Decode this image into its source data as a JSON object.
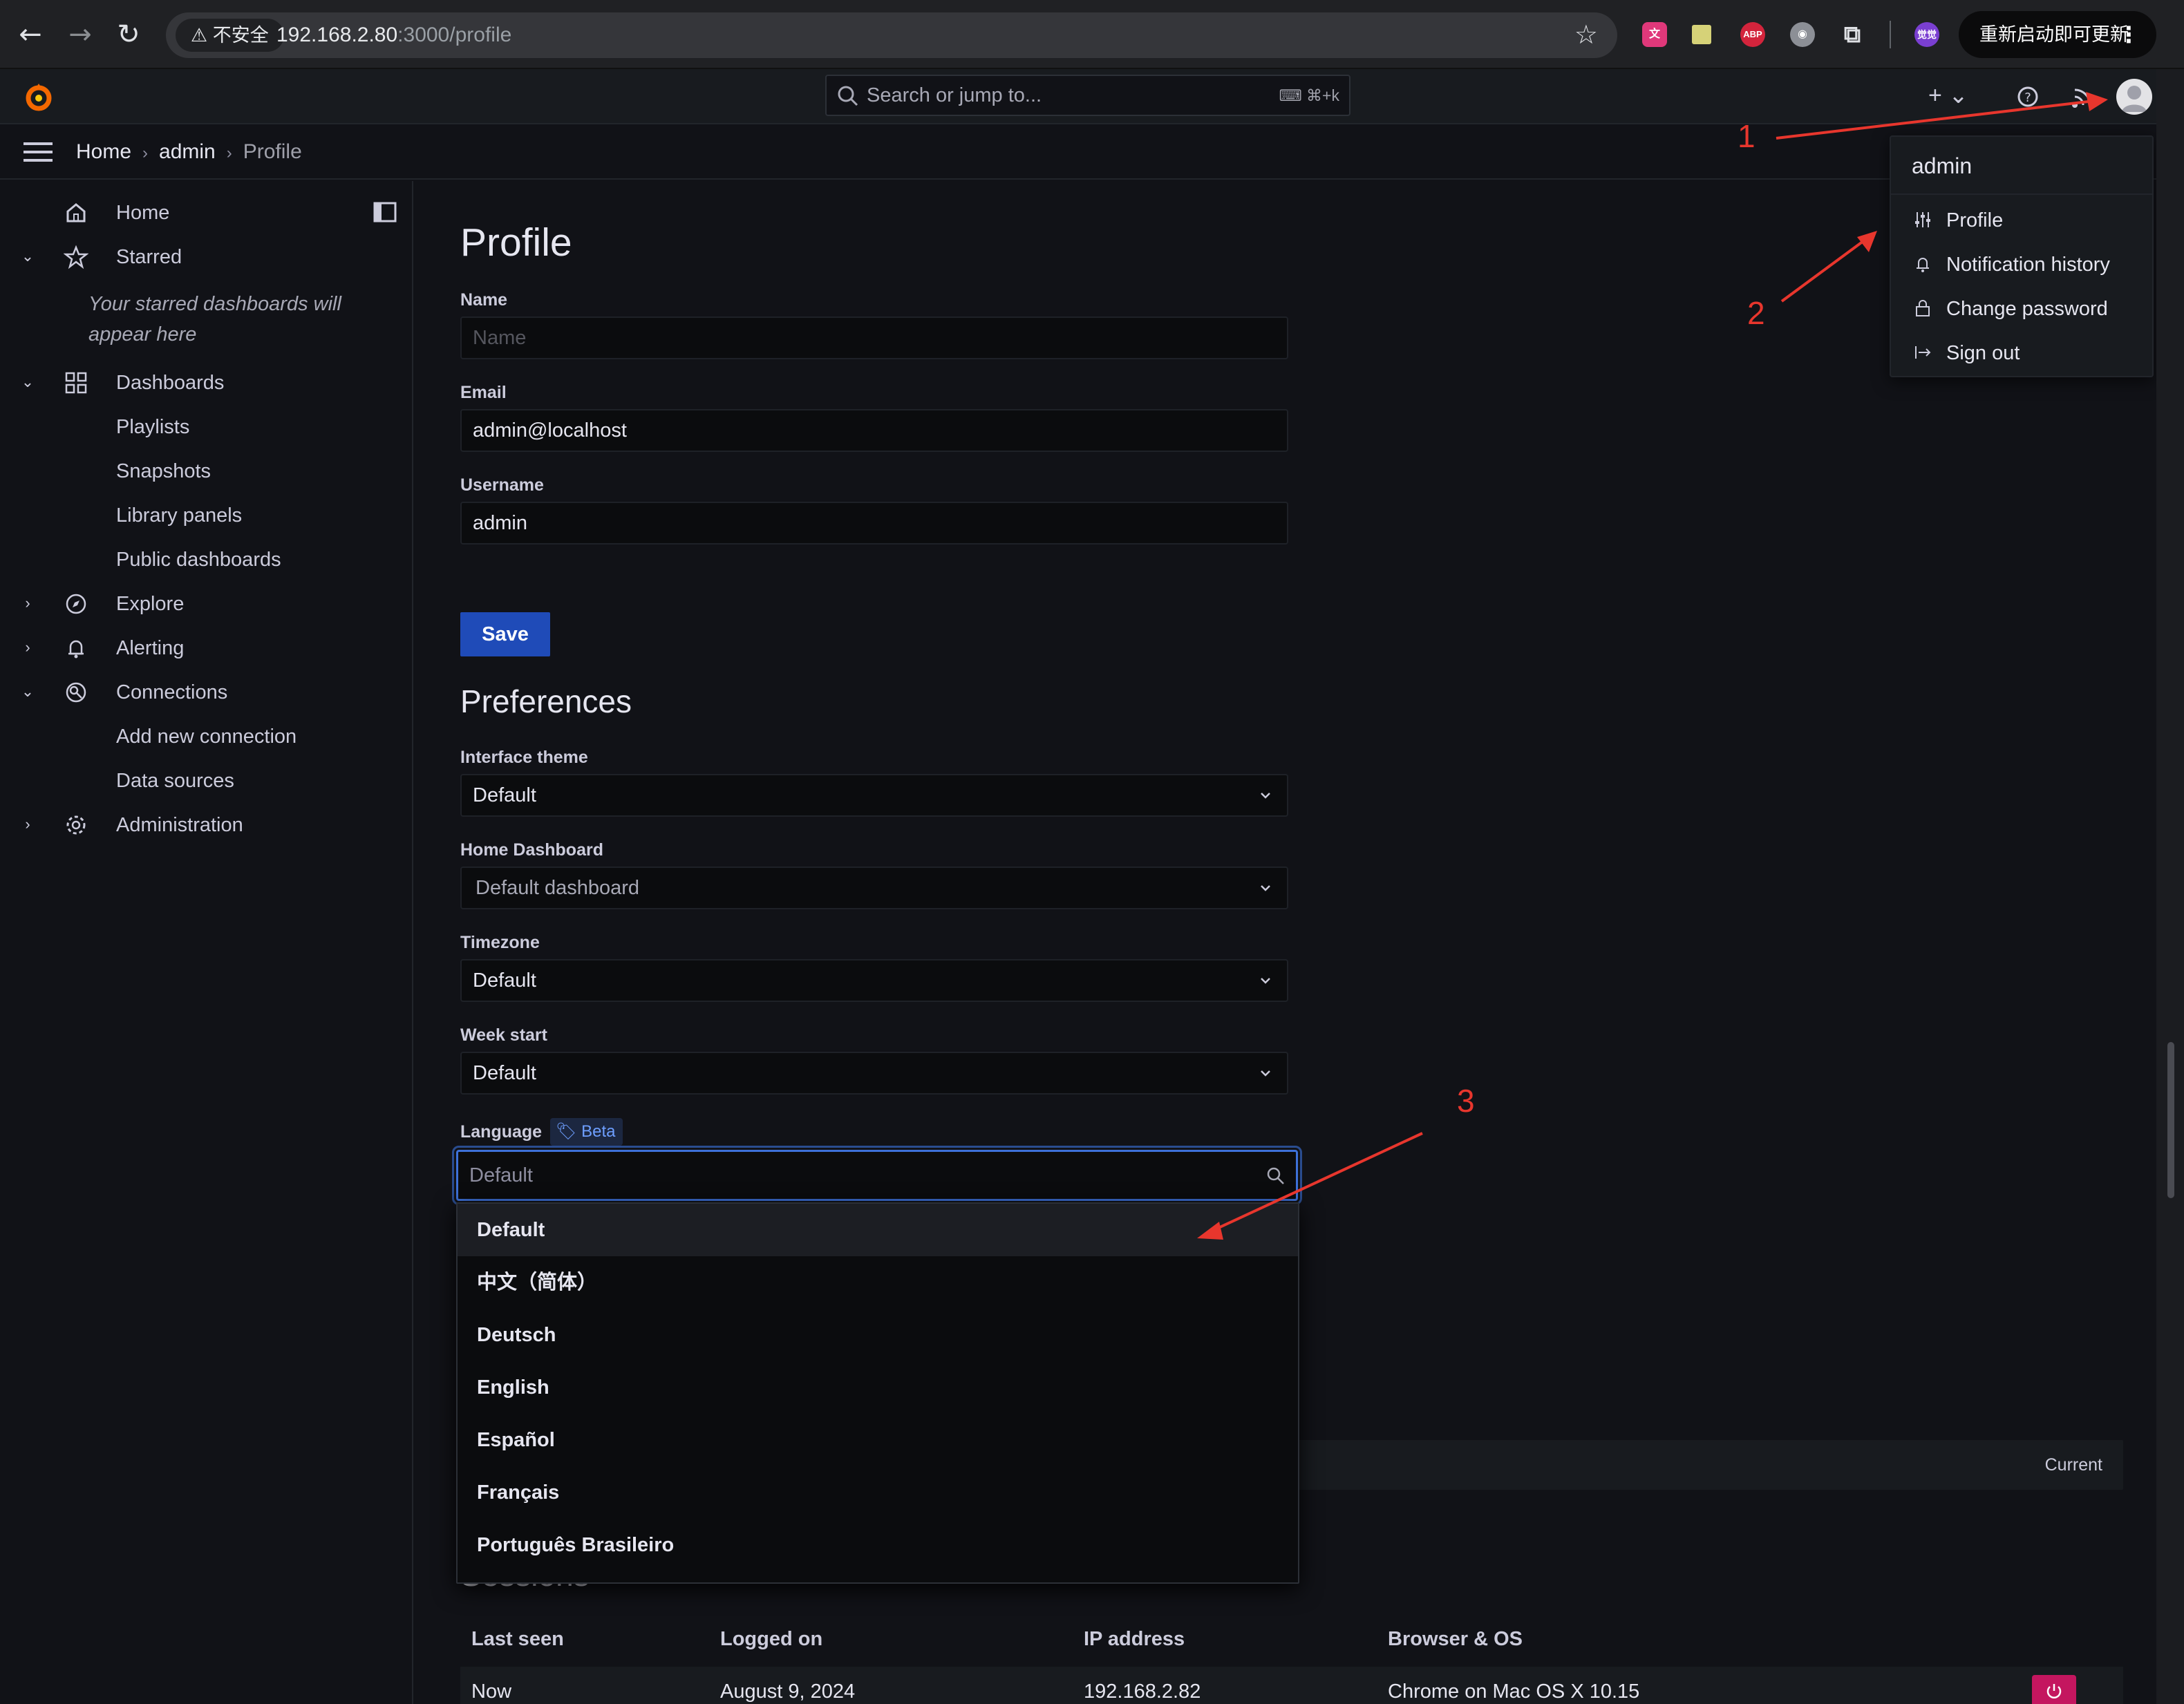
{
  "browser": {
    "insecure_label": "⚠ 不安全",
    "url_host": "192.168.2.80",
    "url_path": ":3000/profile",
    "update_label": "重新启动即可更新",
    "extensions": [
      {
        "name": "translate-icon",
        "color": "#e0387a"
      },
      {
        "name": "notes-icon",
        "color": "#d6d278"
      },
      {
        "name": "adblock-icon",
        "color": "#d3243c",
        "text": "ABP"
      },
      {
        "name": "spy-icon",
        "color": "#8c8f96"
      },
      {
        "name": "puzzle-icon",
        "color": "#5f6368"
      },
      {
        "name": "profile-icon",
        "color": "#7a3fd1",
        "text": "觉觉"
      }
    ]
  },
  "topbar": {
    "search_placeholder": "Search or jump to...",
    "search_shortcut": "⌨ ⌘+k",
    "add_label": "+ ⌄"
  },
  "breadcrumb": {
    "items": [
      "Home",
      "admin",
      "Profile"
    ]
  },
  "sidebar": {
    "home": "Home",
    "starred": "Starred",
    "starred_empty": "Your starred dashboards will appear here",
    "dashboards": "Dashboards",
    "dashboards_children": [
      "Playlists",
      "Snapshots",
      "Library panels",
      "Public dashboards"
    ],
    "explore": "Explore",
    "alerting": "Alerting",
    "connections": "Connections",
    "connections_children": [
      "Add new connection",
      "Data sources"
    ],
    "administration": "Administration"
  },
  "profile": {
    "title": "Profile",
    "name_label": "Name",
    "name_placeholder": "Name",
    "name_value": "",
    "email_label": "Email",
    "email_value": "admin@localhost",
    "username_label": "Username",
    "username_value": "admin",
    "save_label": "Save"
  },
  "preferences": {
    "title": "Preferences",
    "theme_label": "Interface theme",
    "theme_value": "Default",
    "home_dashboard_label": "Home Dashboard",
    "home_dashboard_value": "Default dashboard",
    "timezone_label": "Timezone",
    "timezone_value": "Default",
    "week_start_label": "Week start",
    "week_start_value": "Default",
    "language_label": "Language",
    "beta_label": "Beta",
    "language_placeholder": "Default",
    "language_options": [
      "Default",
      "中文（简体）",
      "Deutsch",
      "English",
      "Español",
      "Français",
      "Português Brasileiro"
    ]
  },
  "orgs": {
    "current_label": "Current"
  },
  "sessions": {
    "title": "Sessions",
    "columns": [
      "Last seen",
      "Logged on",
      "IP address",
      "Browser & OS"
    ],
    "rows": [
      {
        "last_seen": "Now",
        "logged_on": "August 9, 2024",
        "ip": "192.168.2.82",
        "browser": "Chrome on Mac OS X 10.15"
      }
    ]
  },
  "user_menu": {
    "name": "admin",
    "items": [
      "Profile",
      "Notification history",
      "Change password",
      "Sign out"
    ]
  },
  "annotations": {
    "labels": [
      "1",
      "2",
      "3"
    ],
    "color": "#e8362d"
  }
}
